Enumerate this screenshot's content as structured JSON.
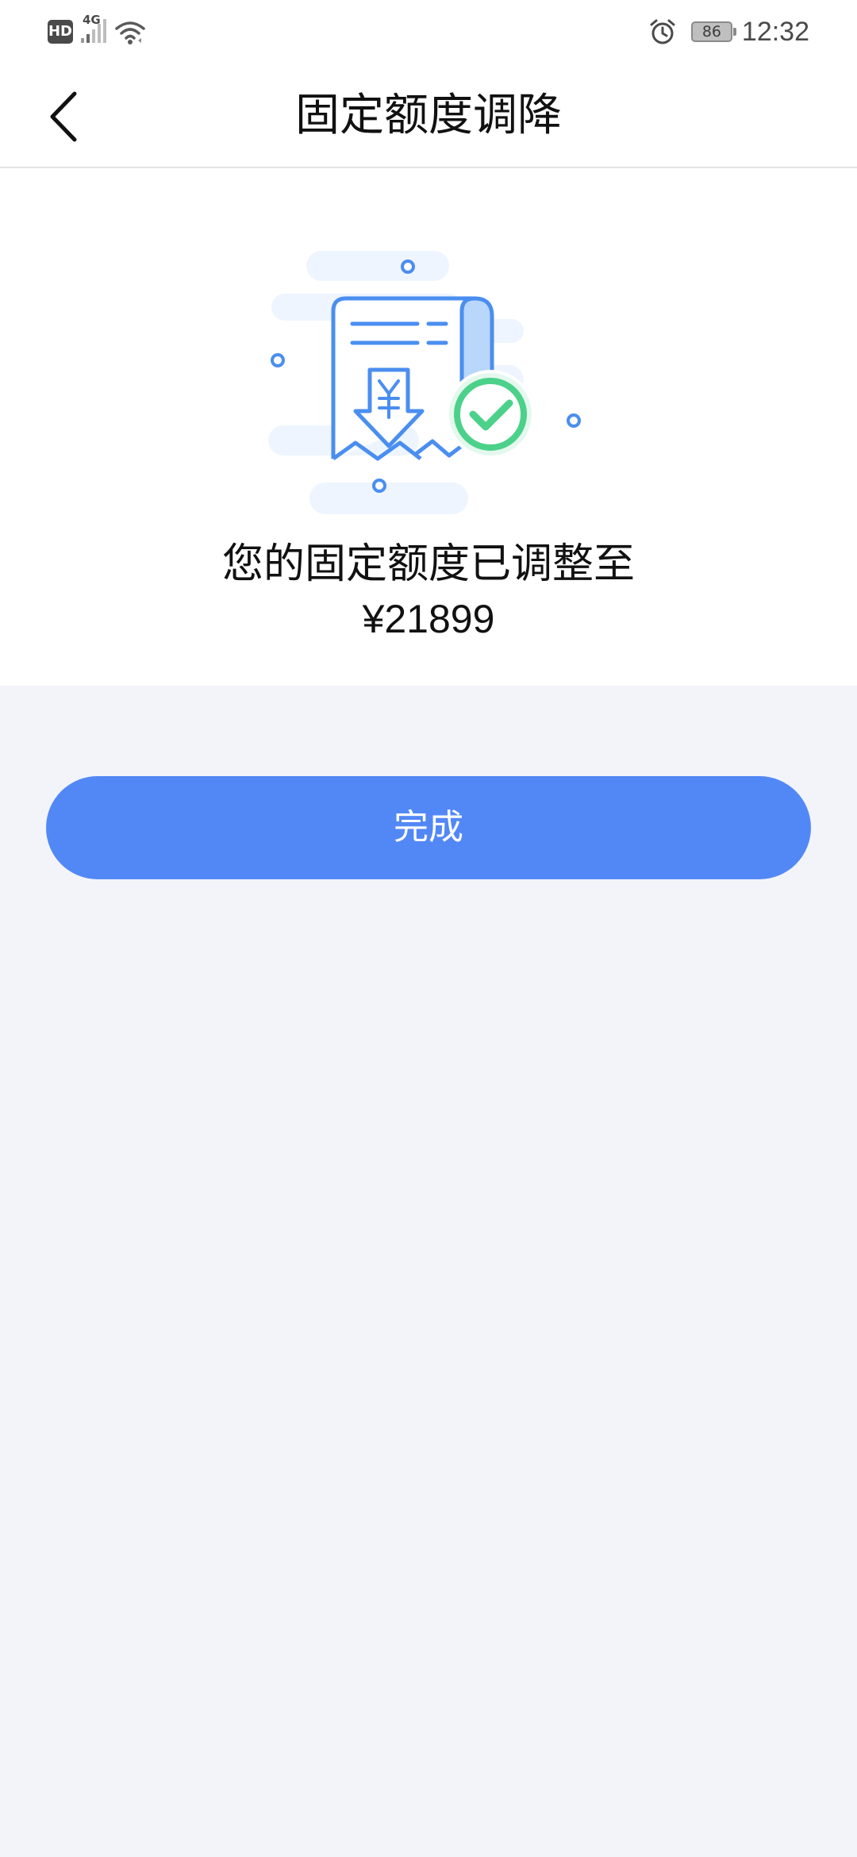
{
  "status_bar": {
    "hd_label": "HD",
    "network_label": "4G",
    "battery_level": "86",
    "time": "12:32",
    "icons": [
      "signal-icon",
      "wifi-icon",
      "alarm-icon",
      "battery-icon"
    ]
  },
  "header": {
    "title": "固定额度调降",
    "back_icon": "chevron-left-icon"
  },
  "result": {
    "illustration_icon": "receipt-success-icon",
    "message": "您的固定额度已调整至",
    "amount": "¥21899"
  },
  "actions": {
    "done_label": "完成"
  },
  "colors": {
    "accent": "#5288f6",
    "background": "#f2f4f9",
    "success": "#4cd18a",
    "illustration_blue": "#4a8ef0"
  }
}
